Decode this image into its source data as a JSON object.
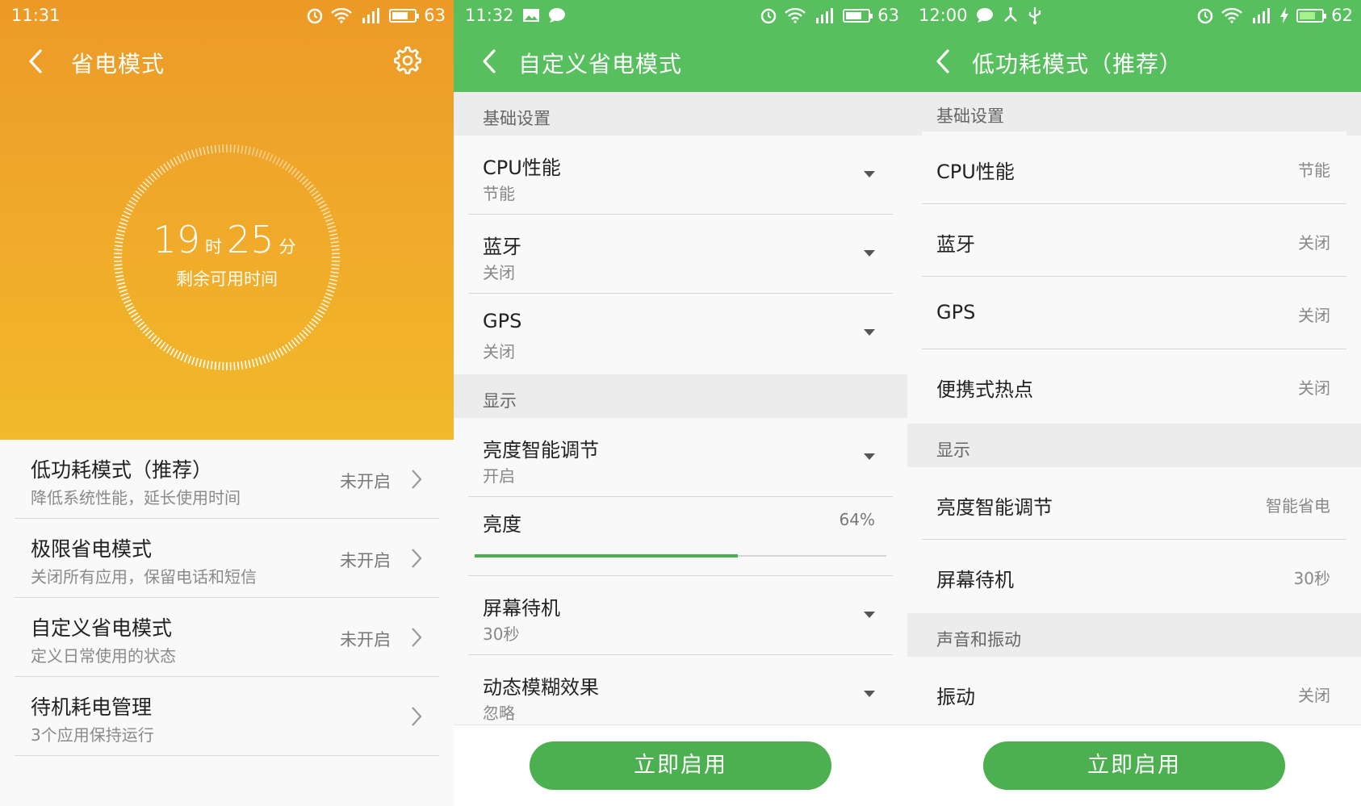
{
  "panel1": {
    "status": {
      "time": "11:31",
      "battery": "63"
    },
    "title": "省电模式",
    "remaining": {
      "hours": "19",
      "hours_unit": "时",
      "minutes": "25",
      "minutes_unit": "分",
      "label": "剩余可用时间"
    },
    "items": [
      {
        "title": "低功耗模式（推荐）",
        "subtitle": "降低系统性能，延长使用时间",
        "status": "未开启"
      },
      {
        "title": "极限省电模式",
        "subtitle": "关闭所有应用，保留电话和短信",
        "status": "未开启"
      },
      {
        "title": "自定义省电模式",
        "subtitle": "定义日常使用的状态",
        "status": "未开启"
      },
      {
        "title": "待机耗电管理",
        "subtitle": "3个应用保持运行",
        "status": ""
      }
    ]
  },
  "panel2": {
    "status": {
      "time": "11:32",
      "battery": "63"
    },
    "title": "自定义省电模式",
    "sections": {
      "basic": "基础设置",
      "display": "显示"
    },
    "basic_items": [
      {
        "title": "CPU性能",
        "value": "节能"
      },
      {
        "title": "蓝牙",
        "value": "关闭"
      },
      {
        "title": "GPS",
        "value": "关闭"
      }
    ],
    "display_items": [
      {
        "title": "亮度智能调节",
        "value": "开启"
      }
    ],
    "brightness": {
      "title": "亮度",
      "value_text": "64%",
      "value": 0.64
    },
    "display_items_after": [
      {
        "title": "屏幕待机",
        "value": "30秒"
      },
      {
        "title": "动态模糊效果",
        "value": "忽略"
      }
    ],
    "button": "立即启用"
  },
  "panel3": {
    "status": {
      "time": "12:00",
      "battery": "62"
    },
    "title": "低功耗模式（推荐）",
    "sections": {
      "basic": "基础设置",
      "display": "显示",
      "sound": "声音和振动"
    },
    "basic_items": [
      {
        "title": "CPU性能",
        "value": "节能"
      },
      {
        "title": "蓝牙",
        "value": "关闭"
      },
      {
        "title": "GPS",
        "value": "关闭"
      },
      {
        "title": "便携式热点",
        "value": "关闭"
      }
    ],
    "display_items": [
      {
        "title": "亮度智能调节",
        "value": "智能省电"
      },
      {
        "title": "屏幕待机",
        "value": "30秒"
      }
    ],
    "sound_items": [
      {
        "title": "振动",
        "value": "关闭"
      }
    ],
    "button": "立即启用"
  },
  "colors": {
    "orange": "#ec9a27",
    "green": "#57bf5e",
    "button_green": "#4caf50"
  }
}
